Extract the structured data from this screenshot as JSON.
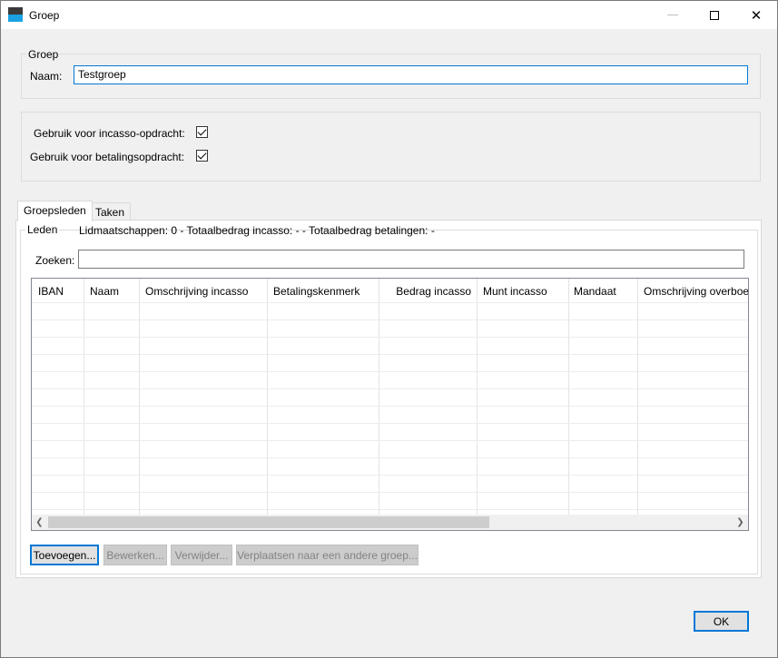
{
  "window": {
    "title": "Groep"
  },
  "group_section": {
    "legend": "Groep",
    "name_label": "Naam:",
    "name_value": "Testgroep"
  },
  "options": {
    "incasso_label": "Gebruik voor incasso-opdracht:",
    "incasso_checked": true,
    "betaling_label": "Gebruik voor betalingsopdracht:",
    "betaling_checked": true
  },
  "tabs": [
    {
      "label": "Groepsleden",
      "active": true
    },
    {
      "label": "Taken",
      "active": false
    }
  ],
  "members": {
    "legend": "Leden",
    "summary": "Lidmaatschappen: 0 - Totaalbedrag incasso: - - Totaalbedrag betalingen: -",
    "search_label": "Zoeken:",
    "search_value": "",
    "columns": [
      "IBAN",
      "Naam",
      "Omschrijving incasso",
      "Betalingskenmerk",
      "Bedrag incasso",
      "Munt incasso",
      "Mandaat",
      "Omschrijving overboe"
    ],
    "rows": []
  },
  "buttons": {
    "add": "Toevoegen...",
    "edit": "Bewerken...",
    "delete": "Verwijder...",
    "move": "Verplaatsen naar een andere groep...",
    "ok": "OK"
  }
}
